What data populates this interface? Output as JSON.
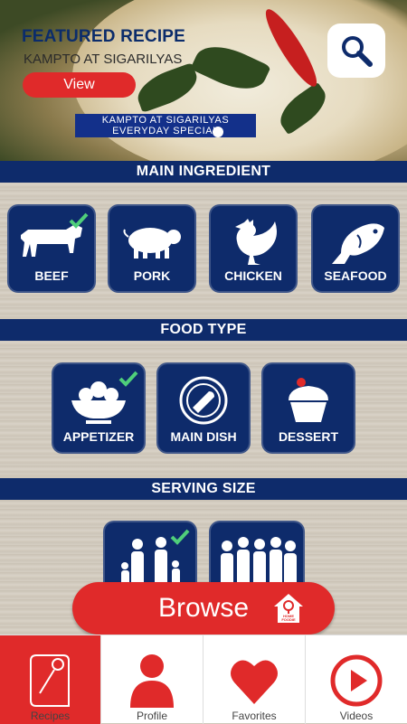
{
  "featured": {
    "heading": "FEATURED RECIPE",
    "name": "KAMPTO AT SIGARILYAS",
    "view_label": "View",
    "caption_line1": "KAMPTO AT SIGARILYAS",
    "caption_line2": "EVERYDAY SPECIAL"
  },
  "sections": {
    "main_ingredient": "MAIN INGREDIENT",
    "food_type": "FOOD TYPE",
    "serving_size": "SERVING SIZE"
  },
  "ingredients": [
    {
      "label": "BEEF",
      "icon": "cow-icon",
      "checked": true
    },
    {
      "label": "PORK",
      "icon": "pig-icon",
      "checked": false
    },
    {
      "label": "CHICKEN",
      "icon": "chicken-icon",
      "checked": false
    },
    {
      "label": "SEAFOOD",
      "icon": "fish-icon",
      "checked": false
    }
  ],
  "food_types": [
    {
      "label": "APPETIZER",
      "icon": "salad-bowl-icon",
      "checked": true
    },
    {
      "label": "MAIN DISH",
      "icon": "plate-steak-icon",
      "checked": false
    },
    {
      "label": "DESSERT",
      "icon": "cupcake-icon",
      "checked": false
    }
  ],
  "serving": [
    {
      "label": "",
      "icon": "family-icon",
      "checked": true
    },
    {
      "label": "",
      "icon": "crowd-icon",
      "checked": false
    }
  ],
  "browse_label": "Browse",
  "badge_text": "HOME FOODIE",
  "nav": [
    {
      "label": "Recipes",
      "icon": "recipe-book-icon",
      "active": true
    },
    {
      "label": "Profile",
      "icon": "profile-icon",
      "active": false
    },
    {
      "label": "Favorites",
      "icon": "heart-icon",
      "active": false
    },
    {
      "label": "Videos",
      "icon": "play-icon",
      "active": false
    }
  ],
  "colors": {
    "navy": "#0e2b6b",
    "red": "#e02a2a",
    "check": "#4fcf7a"
  }
}
